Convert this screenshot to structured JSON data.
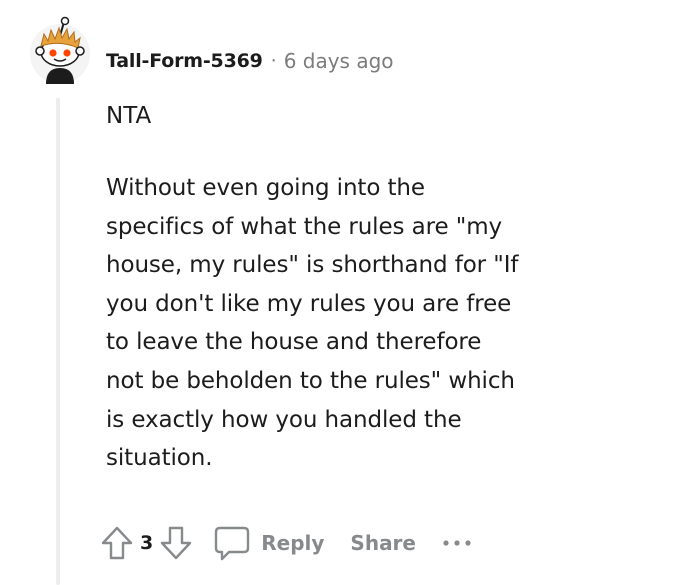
{
  "comment": {
    "username": "Tall-Form-5369",
    "separator": "·",
    "timestamp": "6 days ago",
    "paragraphs": [
      "NTA",
      "Without even going into the specifics of what the rules are \"my house, my rules\" is shorthand for \"If you don't like my rules you are free to leave the house and therefore not be beholden to the rules\" which is exactly how you handled the situation."
    ],
    "body_lines": [
      "Without even going into the",
      "specifics of what the rules are \"my",
      "house, my rules\" is shorthand for \"If",
      "you don't like my rules you are free",
      "to leave the house and therefore",
      "not be beholden to the rules\" which",
      "is exactly how you handled the",
      "situation."
    ]
  },
  "actions": {
    "vote_count": "3",
    "reply_label": "Reply",
    "share_label": "Share"
  },
  "icons": {
    "avatar": "reddit-snoo-avatar",
    "upvote": "arrow-up-icon",
    "downvote": "arrow-down-icon",
    "comment": "comment-bubble-icon",
    "more": "more-horizontal-icon"
  },
  "colors": {
    "text": "#1c1c1c",
    "meta": "#7c7c7c",
    "action": "#878a8c",
    "thread_line": "#ededed",
    "snoo_hair": "#e8a23c",
    "snoo_eye": "#ff4500"
  }
}
